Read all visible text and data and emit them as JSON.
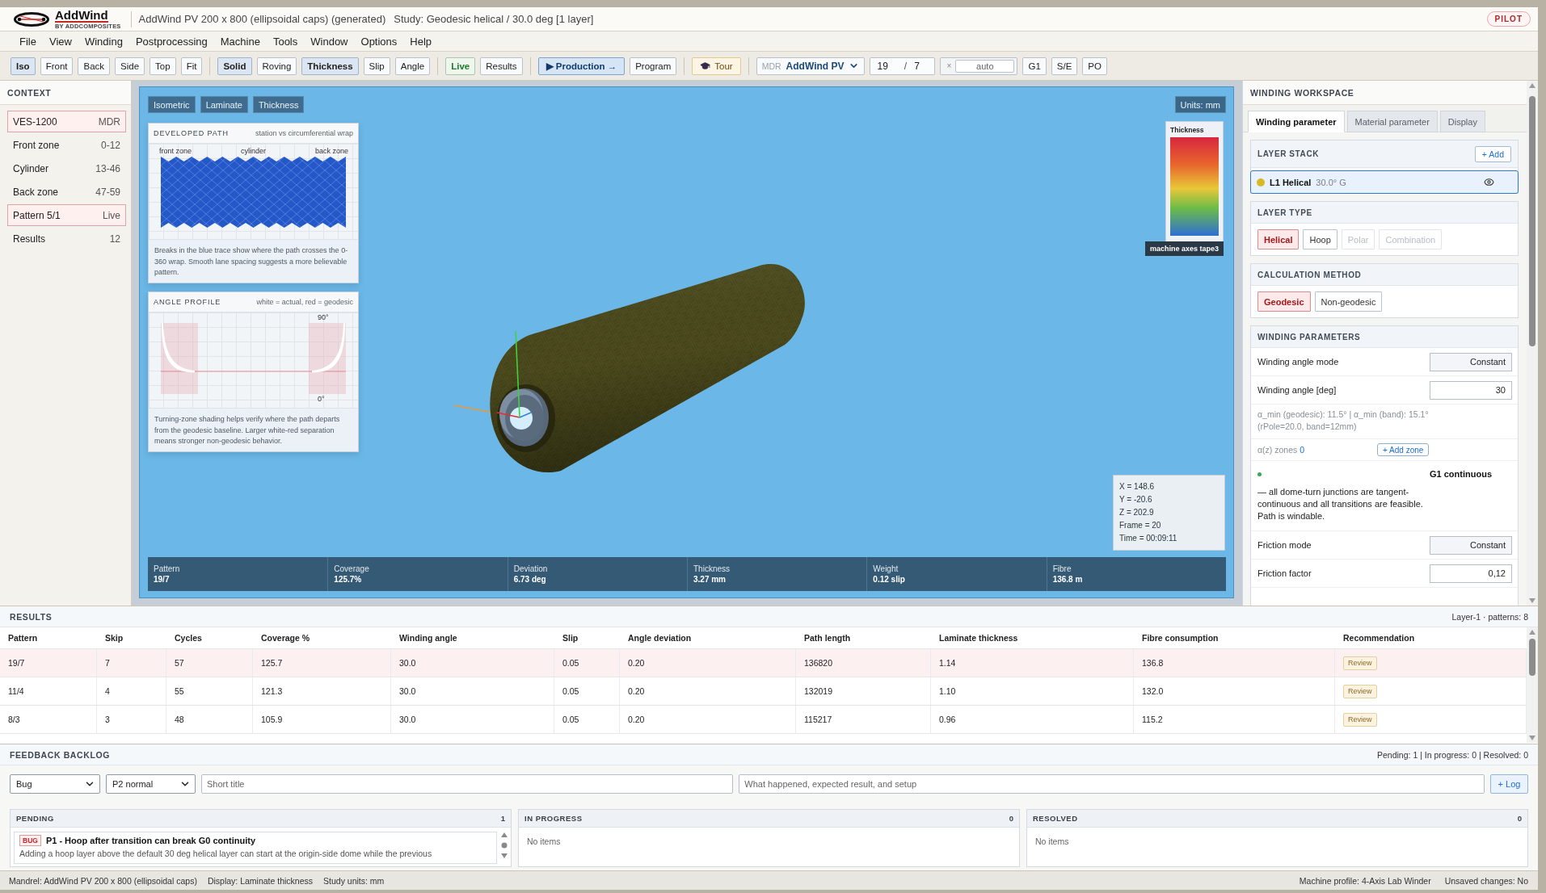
{
  "title_bar": {
    "logo": {
      "wordmark": "AddWind",
      "tagline": "BY ADDCOMPOSITES"
    },
    "document": "AddWind PV 200 x 800 (ellipsoidal caps) (generated)",
    "study": "Study: Geodesic helical / 30.0 deg [1 layer]",
    "badge": "PILOT"
  },
  "menu": [
    "File",
    "View",
    "Winding",
    "Postprocessing",
    "Machine",
    "Tools",
    "Window",
    "Options",
    "Help"
  ],
  "toolbar": {
    "groups": [
      {
        "items": [
          {
            "kind": "button",
            "label": "Iso",
            "selected": true
          },
          {
            "kind": "button",
            "label": "Front",
            "selected": false
          },
          {
            "kind": "button",
            "label": "Back",
            "selected": false
          },
          {
            "kind": "button",
            "label": "Side",
            "selected": false
          },
          {
            "kind": "button",
            "label": "Top",
            "selected": false
          },
          {
            "kind": "button",
            "label": "Fit",
            "selected": false
          }
        ]
      },
      {
        "items": [
          {
            "kind": "button",
            "label": "Solid",
            "selected": true
          },
          {
            "kind": "button",
            "label": "Roving",
            "selected": false
          },
          {
            "kind": "button",
            "label": "Thickness",
            "selected": true
          },
          {
            "kind": "button",
            "label": "Slip",
            "selected": false
          },
          {
            "kind": "button",
            "label": "Angle",
            "selected": false
          }
        ]
      },
      {
        "items": [
          {
            "kind": "toggle",
            "label": "Live",
            "on": true
          },
          {
            "kind": "button",
            "label": "Results",
            "selected": false
          }
        ]
      },
      {
        "items": [
          {
            "kind": "primary",
            "label": "▶ Production →"
          },
          {
            "kind": "button",
            "label": "Program",
            "selected": false
          }
        ]
      },
      {
        "items": [
          {
            "kind": "tour",
            "label": "Tour"
          }
        ]
      },
      {
        "items": [
          {
            "kind": "select",
            "prefix": "MDR",
            "value": "AddWind PV"
          },
          {
            "kind": "pattern",
            "values": [
              "19",
              "7"
            ],
            "divider": "/"
          },
          {
            "kind": "field",
            "prefix": "×",
            "value": "auto"
          },
          {
            "kind": "button",
            "label": "G1",
            "selected": false
          },
          {
            "kind": "button",
            "label": "S/E",
            "selected": false
          },
          {
            "kind": "button",
            "label": "PO",
            "selected": false
          }
        ]
      }
    ]
  },
  "context": {
    "title": "CONTEXT",
    "items": [
      {
        "label": "VES-1200",
        "value": "MDR",
        "selected": true
      },
      {
        "label": "Front zone",
        "value": "0-12",
        "selected": false
      },
      {
        "label": "Cylinder",
        "value": "13-46",
        "selected": false
      },
      {
        "label": "Back zone",
        "value": "47-59",
        "selected": false
      },
      {
        "label": "Pattern 5/1",
        "value": "Live",
        "selected": true
      },
      {
        "label": "Results",
        "value": "12",
        "selected": false
      }
    ]
  },
  "viewport": {
    "view_tabs": [
      "Isometric",
      "Laminate",
      "Thickness"
    ],
    "units": "Units: mm",
    "cards": [
      {
        "kind": "trace",
        "title": "DEVELOPED PATH",
        "subtitle": "station vs circumferential wrap",
        "labels": [
          "front zone",
          "cylinder",
          "back zone"
        ],
        "caption": "Breaks in the blue trace show where the path crosses the 0-360 wrap. Smooth lane spacing suggests a more believable pattern."
      },
      {
        "kind": "profile",
        "title": "ANGLE PROFILE",
        "subtitle": "white = actual, red = geodesic",
        "labels": [
          "90°",
          "0°"
        ],
        "caption": "Turning-zone shading helps verify where the path departs from the geodesic baseline. Larger white-red separation means stronger non-geodesic behavior."
      }
    ],
    "legend": {
      "title": "Thickness",
      "tooltip": "machine axes tape3"
    },
    "readout": [
      "X = 148.6",
      "Y = -20.6",
      "Z = 202.9",
      "Frame = 20",
      "Time = 00:09:11"
    ],
    "stats": [
      {
        "label": "Pattern",
        "value": "19/7"
      },
      {
        "label": "Coverage",
        "value": "125.7%"
      },
      {
        "label": "Deviation",
        "value": "6.73 deg"
      },
      {
        "label": "Thickness",
        "value": "3.27 mm"
      },
      {
        "label": "Weight",
        "value": "0.12 slip"
      },
      {
        "label": "Fibre",
        "value": "136.8 m"
      }
    ]
  },
  "workspace": {
    "title": "WINDING WORKSPACE",
    "tabs": [
      {
        "label": "Winding parameter",
        "selected": true
      },
      {
        "label": "Material parameter",
        "selected": false
      },
      {
        "label": "Display",
        "selected": false
      }
    ],
    "layer_stack": {
      "title": "LAYER STACK",
      "add": "+ Add",
      "layers": [
        {
          "name": "L1 Helical",
          "detail": "30.0° G",
          "color": "#d9b826",
          "selected": true
        }
      ]
    },
    "layer_type": {
      "title": "LAYER TYPE",
      "options": [
        {
          "label": "Helical",
          "selected": true,
          "disabled": false
        },
        {
          "label": "Hoop",
          "selected": false,
          "disabled": false
        },
        {
          "label": "Polar",
          "selected": false,
          "disabled": true
        },
        {
          "label": "Combination",
          "selected": false,
          "disabled": true
        }
      ]
    },
    "calculation_method": {
      "title": "CALCULATION METHOD",
      "options": [
        {
          "label": "Geodesic",
          "selected": true
        },
        {
          "label": "Non-geodesic",
          "selected": false
        }
      ]
    },
    "winding_parameters": {
      "title": "WINDING PARAMETERS",
      "rows": [
        {
          "kind": "select",
          "label": "Winding angle mode",
          "value": "Constant"
        },
        {
          "kind": "input",
          "label": "Winding angle [deg]",
          "value": "30"
        },
        {
          "kind": "note",
          "text": "α_min (geodesic): 11.5° | α_min (band): 15.1° (rPole=20.0, band=12mm)"
        },
        {
          "kind": "zones",
          "label": "α(z) zones",
          "count": "0",
          "action": "+ Add zone"
        },
        {
          "kind": "status",
          "ok": true,
          "title": "G1 continuous",
          "text": "— all dome-turn junctions are tangent-continuous and all transitions are feasible. Path is windable."
        },
        {
          "kind": "select",
          "label": "Friction mode",
          "value": "Constant"
        },
        {
          "kind": "input",
          "label": "Friction factor",
          "value": "0,12"
        }
      ]
    }
  },
  "results": {
    "title": "RESULTS",
    "summary": "Layer-1 · patterns: 8",
    "columns": [
      "Pattern",
      "Skip",
      "Cycles",
      "Coverage %",
      "Winding angle",
      "Slip",
      "Angle deviation",
      "Path length",
      "Laminate thickness",
      "Fibre consumption",
      "Recommendation"
    ],
    "rows": [
      {
        "cells": [
          "19/7",
          "7",
          "57",
          "125.7",
          "30.0",
          "0.05",
          "0.20",
          "136820",
          "1.14",
          "136.8"
        ],
        "recommendation": "Review",
        "selected": true
      },
      {
        "cells": [
          "11/4",
          "4",
          "55",
          "121.3",
          "30.0",
          "0.05",
          "0.20",
          "132019",
          "1.10",
          "132.0"
        ],
        "recommendation": "Review",
        "selected": false
      },
      {
        "cells": [
          "8/3",
          "3",
          "48",
          "105.9",
          "30.0",
          "0.05",
          "0.20",
          "115217",
          "0.96",
          "115.2"
        ],
        "recommendation": "Review",
        "selected": false
      }
    ]
  },
  "feedback": {
    "title": "FEEDBACK BACKLOG",
    "summary": "Pending: 1 | In progress: 0 | Resolved: 0",
    "selects": [
      "Bug",
      "P2 normal"
    ],
    "title_field": {
      "placeholder": "Short title"
    },
    "details_field": {
      "placeholder": "What happened, expected result, and setup"
    },
    "submit": "+ Log",
    "columns": [
      {
        "title": "PENDING",
        "count": "1",
        "items": [
          {
            "tag": "BUG",
            "title": "P1 - Hoop after transition can break G0 continuity",
            "text": "Adding a hoop layer above the default 30 deg helical layer can start at the origin-side dome while the previous"
          }
        ]
      },
      {
        "title": "IN PROGRESS",
        "count": "0",
        "empty": "No items"
      },
      {
        "title": "RESOLVED",
        "count": "0",
        "empty": "No items"
      }
    ]
  },
  "status_bar": {
    "left": [
      "Mandrel: AddWind PV 200 x 800 (ellipsoidal caps)",
      "Display: Laminate thickness",
      "Study units: mm"
    ],
    "right": [
      "Machine profile: 4-Axis Lab Winder",
      "Unsaved changes: No"
    ]
  }
}
